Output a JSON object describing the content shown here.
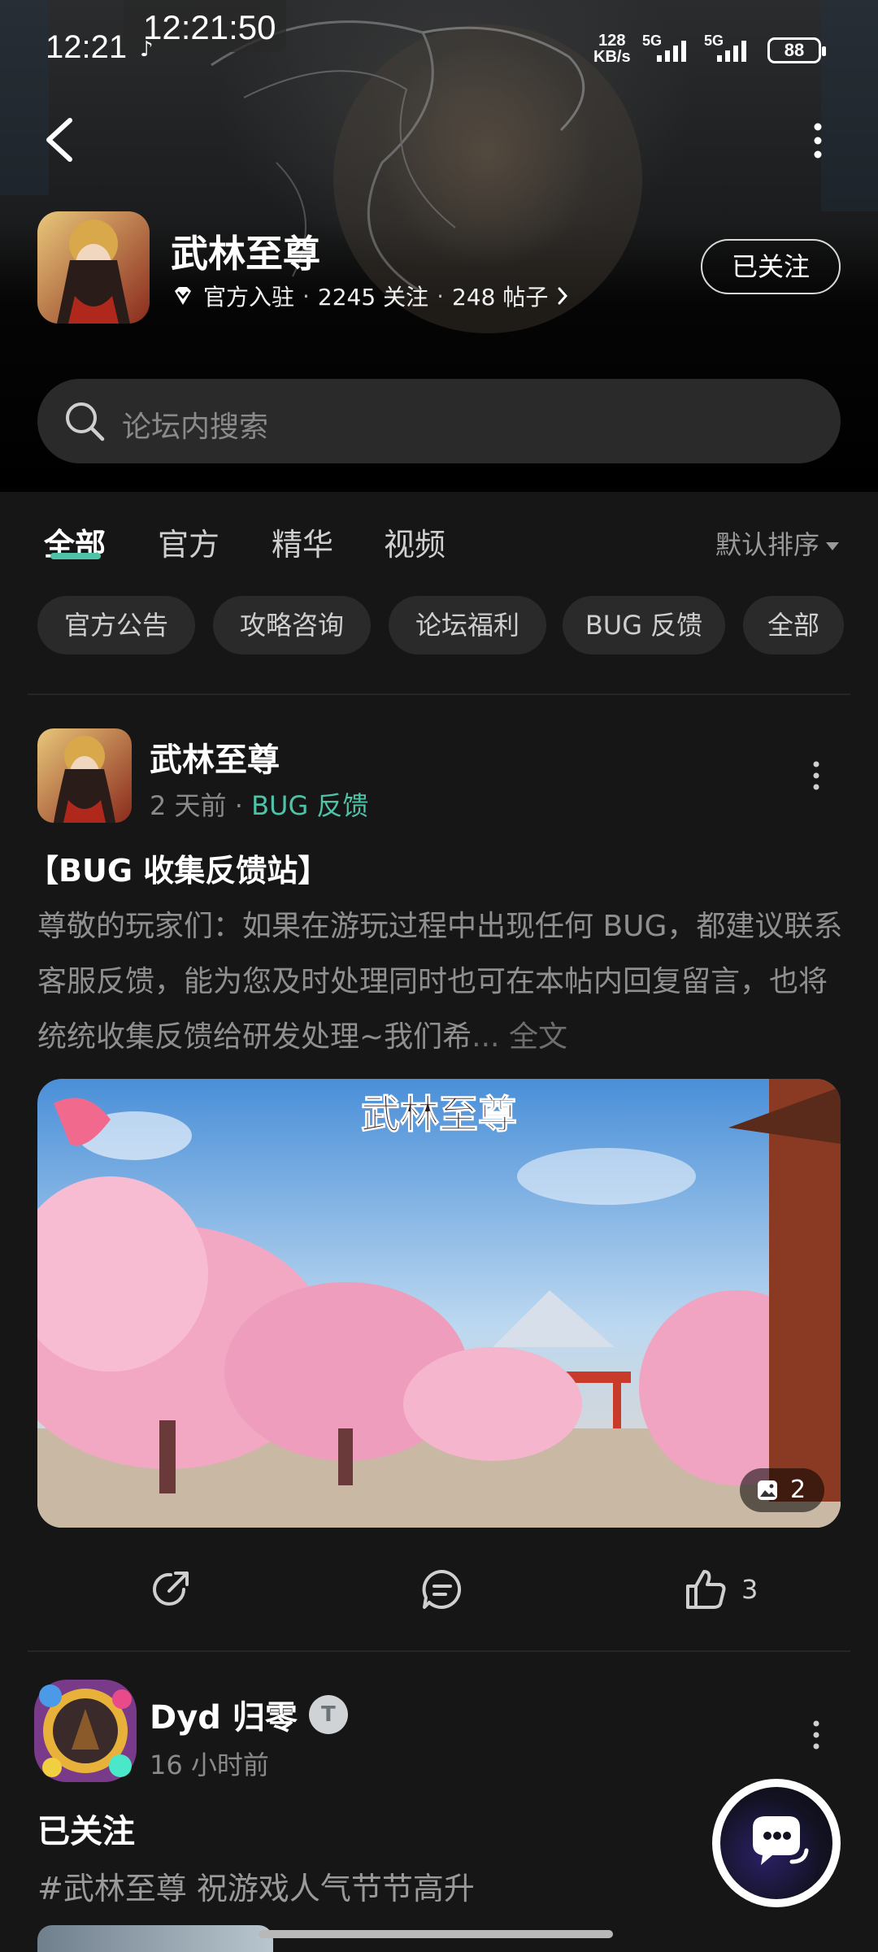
{
  "status_bar": {
    "time": "12:21",
    "clock_overlay": "12:21:50",
    "net_speed_value": "128",
    "net_speed_unit": "KB/s",
    "sim1_label": "5G",
    "sim2_label": "5G",
    "battery": "88"
  },
  "header": {
    "forum_name": "武林至尊",
    "official_label": "官方入驻",
    "followers": "2245 关注",
    "posts": "248 帖子",
    "follow_button": "已关注",
    "search_placeholder": "论坛内搜索"
  },
  "tabs": [
    {
      "label": "全部",
      "active": true
    },
    {
      "label": "官方",
      "active": false
    },
    {
      "label": "精华",
      "active": false
    },
    {
      "label": "视频",
      "active": false
    }
  ],
  "sort_label": "默认排序",
  "chips": [
    "官方公告",
    "攻略咨询",
    "论坛福利",
    "BUG 反馈",
    "全部"
  ],
  "post1": {
    "author": "武林至尊",
    "time": "2 天前",
    "category": "BUG 反馈",
    "title": "【BUG 收集反馈站】",
    "body": "尊敬的玩家们：如果在游玩过程中出现任何 BUG，都建议联系客服反馈，能为您及时处理同时也可在本帖内回复留言，也将统统收集反馈给研发处理~我们希",
    "read_more": "... 全文",
    "image_logo": "武林至尊",
    "image_count": "2",
    "like_count": "3"
  },
  "post2": {
    "author": "Dyd 归零",
    "level": "T",
    "time": "16 小时前",
    "title": "已关注",
    "tag_text": "#武林至尊 祝游戏人气节节高升"
  },
  "colors": {
    "accent": "#4fc3a8",
    "background": "#161616",
    "chip_bg": "#2a2a2a",
    "muted_text": "#8a8a8a"
  }
}
